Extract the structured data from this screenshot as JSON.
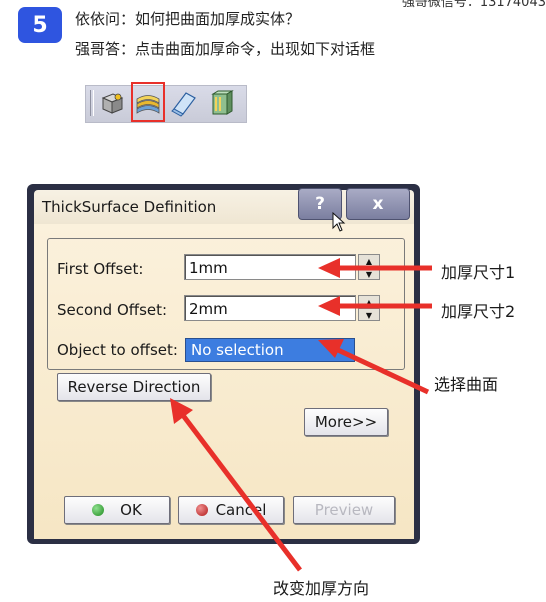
{
  "header": {
    "step_number": "5",
    "question": "依依问：如何把曲面加厚成实体？",
    "answer": "强哥答：点击曲面加厚命令，出现如下对话框",
    "clipped_top_text": "强哥微信号：13174043"
  },
  "toolbar": {
    "icons": [
      "solid-icon",
      "thick-surface-icon",
      "close-surface-icon",
      "sew-surface-icon"
    ],
    "highlighted_icon": "thick-surface-icon",
    "highlight_color": "#e8302a"
  },
  "dialog": {
    "title": "ThickSurface Definition",
    "help_label": "?",
    "close_label": "x",
    "first_offset_label": "First Offset:",
    "first_offset_value": "1mm",
    "second_offset_label": "Second Offset:",
    "second_offset_value": "2mm",
    "object_label": "Object to offset:",
    "object_value": "No selection",
    "reverse_label": "Reverse Direction",
    "more_label": "More>>",
    "ok_label": "OK",
    "cancel_label": "Cancel",
    "preview_label": "Preview"
  },
  "annotations": {
    "first_offset": "加厚尺寸1",
    "second_offset": "加厚尺寸2",
    "select_surface": "选择曲面",
    "reverse_direction": "改变加厚方向",
    "arrow_color": "#e8302a"
  },
  "colors": {
    "badge": "#2f55e0",
    "dialog_body": "#f8ebcf",
    "selection_field": "#3d7de0"
  }
}
